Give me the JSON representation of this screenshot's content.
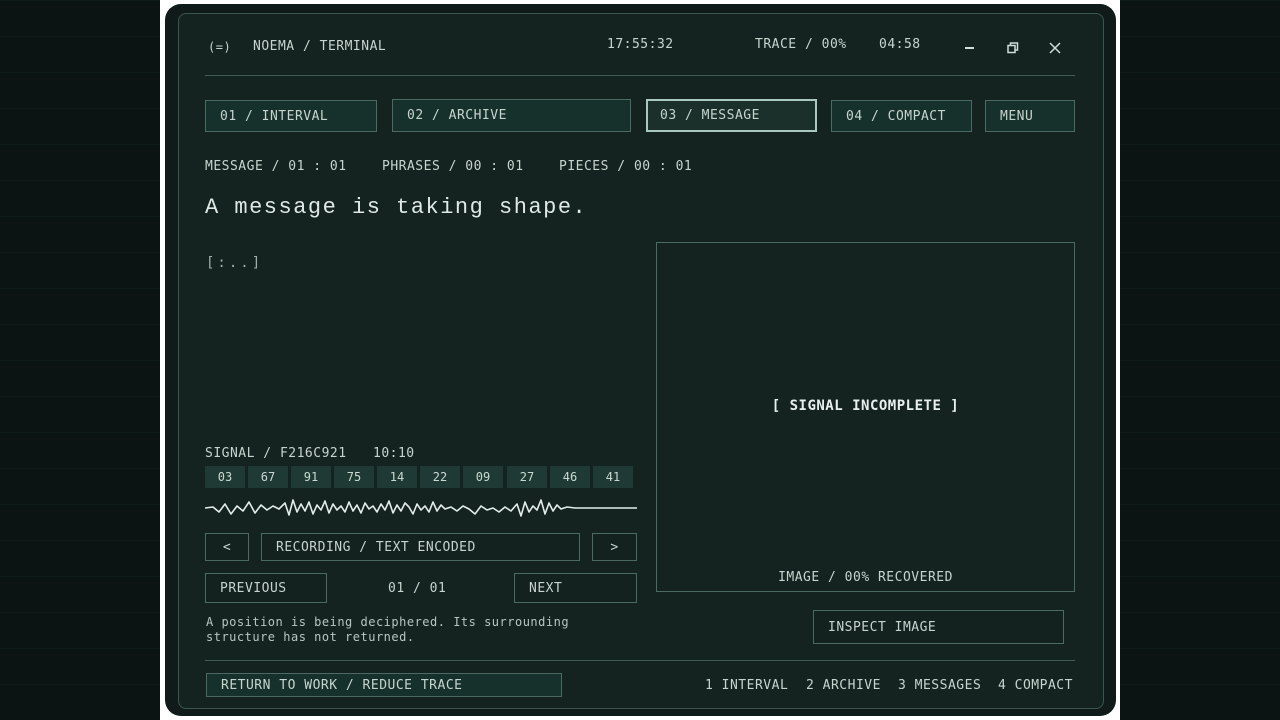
{
  "window": {
    "badge": "(=)",
    "title": "NOEMA / TERMINAL",
    "clock": "17:55:32",
    "trace": "TRACE / 00%",
    "timer": "04:58"
  },
  "tabs": [
    {
      "label": "01 / INTERVAL",
      "active": false
    },
    {
      "label": "02 / ARCHIVE",
      "active": false
    },
    {
      "label": "03 / MESSAGE",
      "active": true
    },
    {
      "label": "04 / COMPACT",
      "active": false
    }
  ],
  "menu_label": "MENU",
  "status": {
    "message": "MESSAGE / 01 : 01",
    "phrases": "PHRASES / 00 : 01",
    "pieces": "PIECES / 00 : 01"
  },
  "headline": "A message is taking shape.",
  "fragment": "[:..]",
  "signal": {
    "id": "SIGNAL / F216C921",
    "time": "10:10",
    "codes": [
      "03",
      "67",
      "91",
      "75",
      "14",
      "22",
      "09",
      "27",
      "46",
      "41"
    ]
  },
  "recording": {
    "prev_glyph": "<",
    "label": "RECORDING / TEXT ENCODED",
    "next_glyph": ">"
  },
  "pager": {
    "previous": "PREVIOUS",
    "count": "01 / 01",
    "next": "NEXT"
  },
  "note": [
    "A position is being deciphered. Its surrounding",
    "structure has not returned."
  ],
  "image_panel": {
    "status": "[ SIGNAL INCOMPLETE ]",
    "recovered": "IMAGE / 00% RECOVERED",
    "inspect": "INSPECT IMAGE"
  },
  "footer": {
    "return_label": "RETURN TO WORK / REDUCE TRACE",
    "shortcuts": [
      "1 INTERVAL",
      "2 ARCHIVE",
      "3 MESSAGES",
      "4 COMPACT"
    ]
  },
  "colors": {
    "background": "#0b1413",
    "panel": "#142320",
    "border": "#4b6a62",
    "text": "#c7d4ce",
    "accent": "#a9c8be"
  }
}
